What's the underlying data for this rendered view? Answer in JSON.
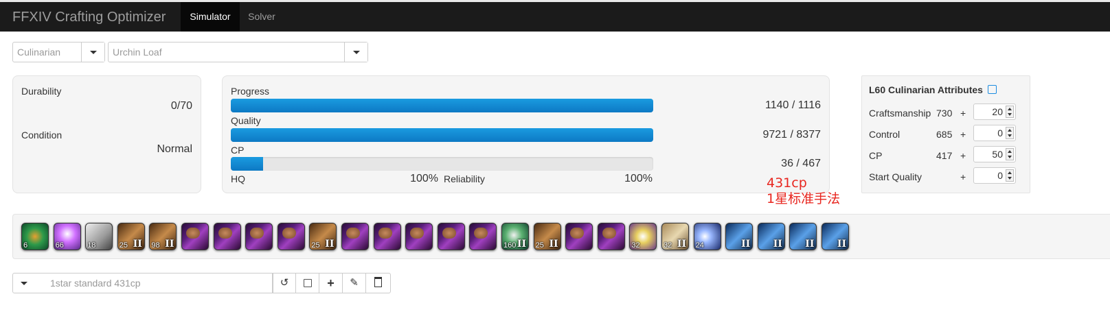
{
  "nav": {
    "brand": "FFXIV Crafting Optimizer",
    "tabs": [
      "Simulator",
      "Solver"
    ]
  },
  "selectors": {
    "class": "Culinarian",
    "recipe": "Urchin Loaf"
  },
  "status": {
    "durability_label": "Durability",
    "durability_value": "0/70",
    "condition_label": "Condition",
    "condition_value": "Normal"
  },
  "progress": {
    "progress_label": "Progress",
    "progress_value": "1140 / 1116",
    "progress_fraction": 1.0,
    "quality_label": "Quality",
    "quality_value": "9721 / 8377",
    "quality_fraction": 1.0,
    "cp_label": "CP",
    "cp_value": "36 / 467",
    "cp_fraction": 0.077,
    "hq_label": "HQ",
    "hq_value": "100%",
    "reliability_label": "Reliability",
    "reliability_value": "100%"
  },
  "annotation": {
    "line1": "431cp",
    "line2": "1星标准手法",
    "color": "#e8261f"
  },
  "attributes": {
    "title": "L60 Culinarian Attributes",
    "rows": [
      {
        "label": "Craftsmanship",
        "base": "730",
        "plus": "+",
        "bonus": "20"
      },
      {
        "label": "Control",
        "base": "685",
        "plus": "+",
        "bonus": "0"
      },
      {
        "label": "CP",
        "base": "417",
        "plus": "+",
        "bonus": "50"
      },
      {
        "label": "Start Quality",
        "base": "",
        "plus": "+",
        "bonus": "0"
      }
    ]
  },
  "actions": [
    {
      "icon": "comfort-zone-icon",
      "num": "6",
      "rank": ""
    },
    {
      "icon": "inner-quiet-icon",
      "num": "66",
      "rank": ""
    },
    {
      "icon": "ingenuity-icon",
      "num": "18",
      "rank": ""
    },
    {
      "icon": "steady-hand-ii-icon",
      "num": "25",
      "rank": "II"
    },
    {
      "icon": "manipulation-ii-icon",
      "num": "98",
      "rank": "II"
    },
    {
      "icon": "hasty-touch-icon",
      "num": "",
      "rank": ""
    },
    {
      "icon": "hasty-touch-icon",
      "num": "",
      "rank": ""
    },
    {
      "icon": "hasty-touch-icon",
      "num": "",
      "rank": ""
    },
    {
      "icon": "hasty-touch-icon",
      "num": "",
      "rank": ""
    },
    {
      "icon": "steady-hand-ii-icon",
      "num": "25",
      "rank": "II"
    },
    {
      "icon": "hasty-touch-icon",
      "num": "",
      "rank": ""
    },
    {
      "icon": "hasty-touch-icon",
      "num": "",
      "rank": ""
    },
    {
      "icon": "hasty-touch-icon",
      "num": "",
      "rank": ""
    },
    {
      "icon": "hasty-touch-icon",
      "num": "",
      "rank": ""
    },
    {
      "icon": "hasty-touch-icon",
      "num": "",
      "rank": ""
    },
    {
      "icon": "great-strides-ii-icon",
      "num": "160",
      "rank": "II"
    },
    {
      "icon": "steady-hand-ii-icon",
      "num": "25",
      "rank": "II"
    },
    {
      "icon": "hasty-touch-icon",
      "num": "",
      "rank": ""
    },
    {
      "icon": "hasty-touch-icon",
      "num": "",
      "rank": ""
    },
    {
      "icon": "innovation-icon",
      "num": "32",
      "rank": ""
    },
    {
      "icon": "byregots-blessing-ii-icon",
      "num": "32",
      "rank": "II"
    },
    {
      "icon": "careful-synthesis-icon",
      "num": "24",
      "rank": ""
    },
    {
      "icon": "careful-synthesis-ii-icon",
      "num": "",
      "rank": "II"
    },
    {
      "icon": "careful-synthesis-ii-icon",
      "num": "",
      "rank": "II"
    },
    {
      "icon": "careful-synthesis-ii-icon",
      "num": "",
      "rank": "II"
    },
    {
      "icon": "careful-synthesis-ii-icon",
      "num": "",
      "rank": "II"
    }
  ],
  "sequence": {
    "name": "1star standard 431cp"
  }
}
